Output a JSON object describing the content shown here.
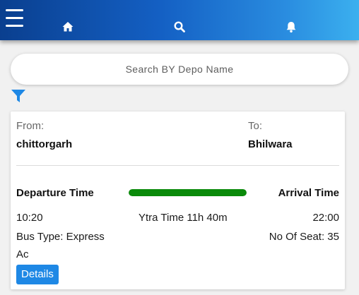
{
  "header": {
    "icons": [
      "menu-icon",
      "home-icon",
      "search-icon",
      "bell-icon"
    ],
    "gradient": [
      "#0a3f8f",
      "#3bb0ef"
    ]
  },
  "search": {
    "placeholder": "Search BY Depo Name",
    "value": ""
  },
  "filter": {
    "icon": "filter-icon",
    "color": "#1e88e5"
  },
  "trip": {
    "from_label": "From:",
    "from_value": "chittorgarh",
    "to_label": "To:",
    "to_value": "Bhilwara",
    "departure_label": "Departure Time",
    "arrival_label": "Arrival Time",
    "departure_time": "10:20",
    "travel_time": "Ytra Time 11h 40m",
    "arrival_time": "22:00",
    "bus_type": "Bus Type: Express",
    "bus_type_extra": "Ac",
    "seats": "No Of Seat: 35",
    "progress_percent": 100,
    "progress_color": "#0a8a0a",
    "details_label": "Details",
    "details_color": "#1e88e5"
  }
}
